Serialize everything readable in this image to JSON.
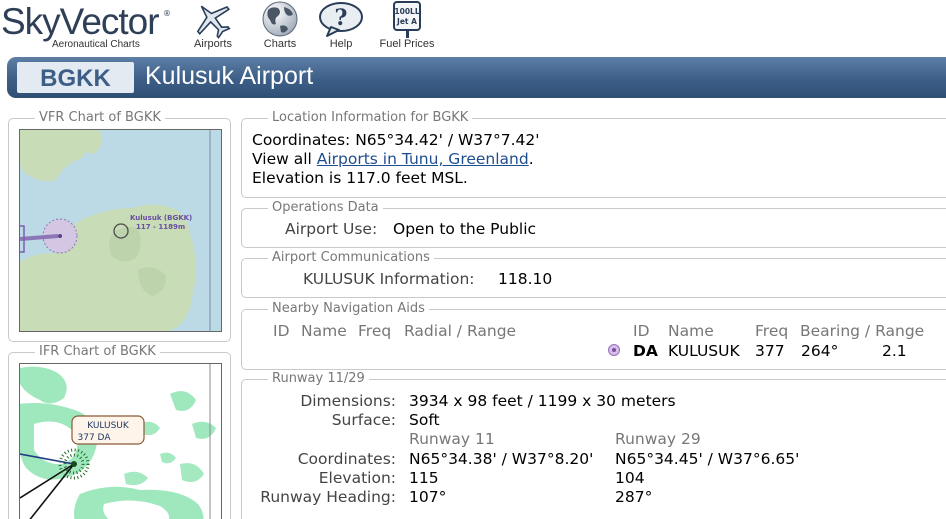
{
  "nav": {
    "logo": {
      "name": "SkyVector",
      "tagline": "Aeronautical Charts"
    },
    "items": [
      {
        "label": "Airports",
        "icon": "airplane-icon"
      },
      {
        "label": "Charts",
        "icon": "globe-icon"
      },
      {
        "label": "Help",
        "icon": "help-icon"
      },
      {
        "label": "Fuel Prices",
        "icon": "fuel-sign-icon"
      }
    ],
    "fuel_sign": {
      "line1": "100LL",
      "line2": "Jet A"
    }
  },
  "header": {
    "ident": "BGKK",
    "name": "Kulusuk Airport"
  },
  "vfr_chart": {
    "legend": "VFR Chart of BGKK",
    "label_name": "Kulusuk (BGKK)",
    "label_info": "117 - 1189m"
  },
  "ifr_chart": {
    "legend": "IFR Chart of BGKK",
    "label_name": "KULUSUK",
    "label_info": "377 DA"
  },
  "location": {
    "legend": "Location Information for BGKK",
    "coordinates": "Coordinates: N65°34.42' / W37°7.42'",
    "view_all_prefix": "View all ",
    "view_all_link": "Airports in Tunu, Greenland",
    "view_all_suffix": ".",
    "elevation": "Elevation is 117.0 feet MSL."
  },
  "operations": {
    "legend": "Operations Data",
    "use_label": "Airport Use:",
    "use_value": "Open to the Public"
  },
  "communications": {
    "legend": "Airport Communications",
    "label": "KULUSUK Information:",
    "value": "118.10"
  },
  "navaids": {
    "legend": "Nearby Navigation Aids",
    "left_headers": [
      "ID",
      "Name",
      "Freq",
      "Radial / Range"
    ],
    "right_headers": [
      "ID",
      "Name",
      "Freq",
      "Bearing / Range"
    ],
    "row": {
      "id": "DA",
      "name": "KULUSUK",
      "freq": "377",
      "bearing": "264°",
      "range": "2.1"
    }
  },
  "runway": {
    "legend": "Runway 11/29",
    "dimensions_label": "Dimensions:",
    "dimensions_value": "3934 x 98 feet / 1199 x 30 meters",
    "surface_label": "Surface:",
    "surface_value": "Soft",
    "end1": "Runway 11",
    "end2": "Runway 29",
    "coord_label": "Coordinates:",
    "coord1": "N65°34.38' / W37°8.20'",
    "coord2": "N65°34.45' / W37°6.65'",
    "elev_label": "Elevation:",
    "elev1": "115",
    "elev2": "104",
    "heading_label": "Runway Heading:",
    "heading1": "107°",
    "heading2": "287°"
  }
}
